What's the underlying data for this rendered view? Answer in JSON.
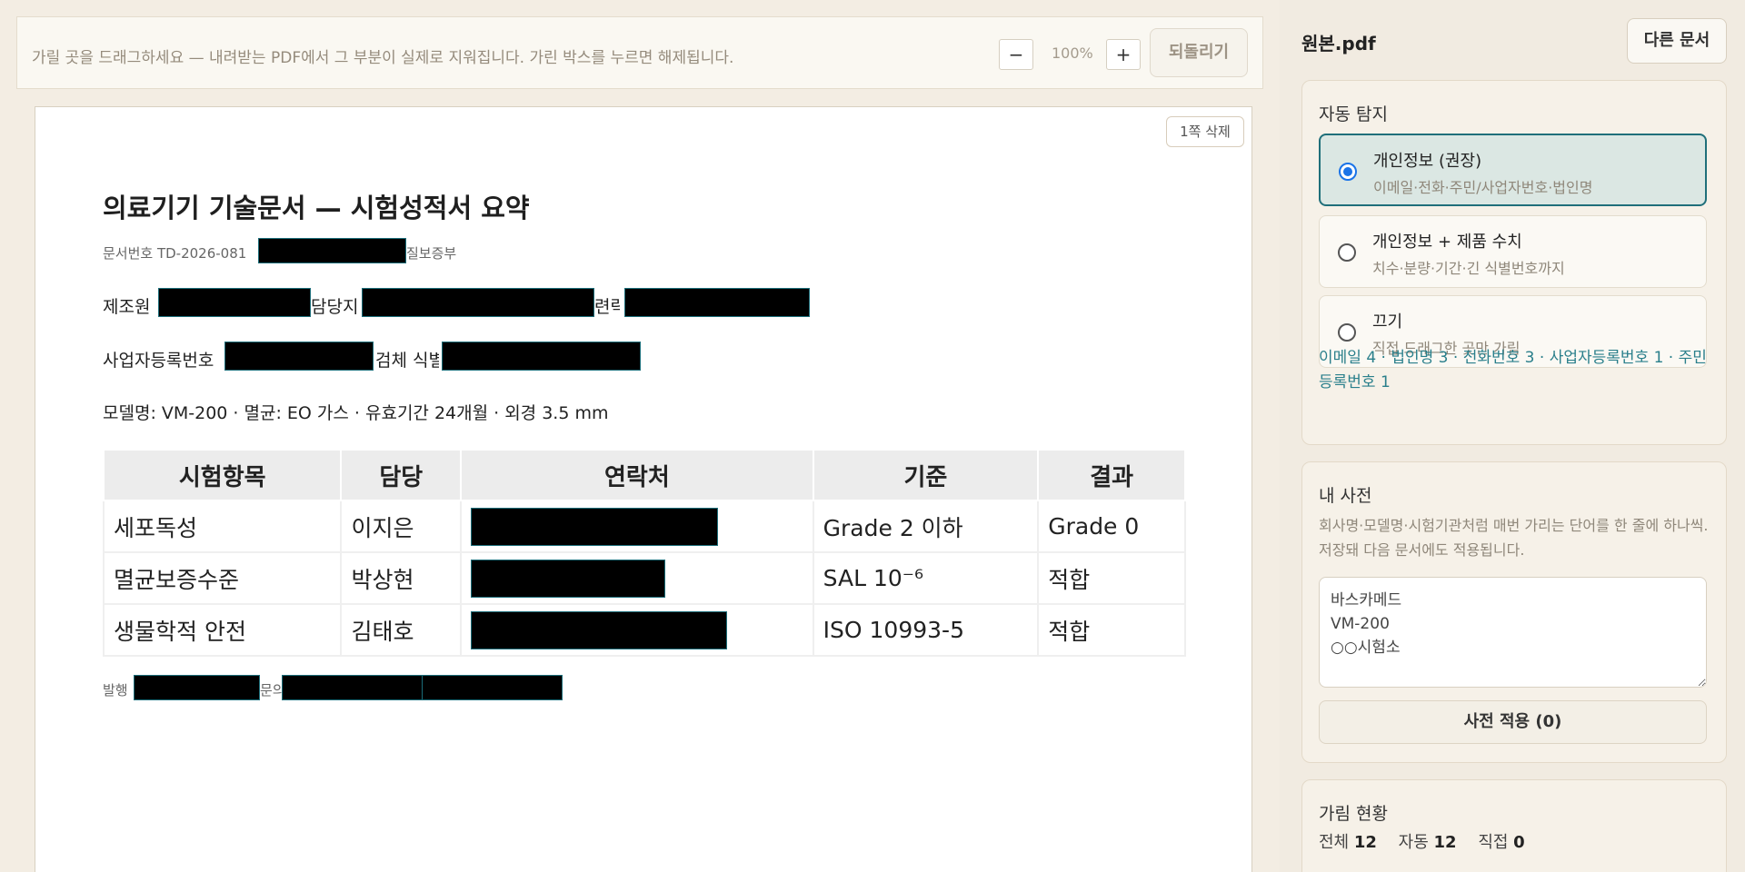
{
  "toolbar": {
    "hint": "가릴 곳을 드래그하세요 — 내려받는 PDF에서 그 부분이 실제로 지워집니다. 가린 박스를 누르면 해제됩니다.",
    "zoom_out": "−",
    "zoom_level": "100%",
    "zoom_in": "+",
    "undo": "되돌리기"
  },
  "page": {
    "delete_page": "1쪽 삭제",
    "title": "의료기기 기술문서 — 시험성적서 요약",
    "doc_no_prefix": "문서번호 TD-2026-081",
    "doc_no_suffix": "질보증부",
    "line_maker_1": "제조원",
    "line_maker_2": "담당지",
    "line_maker_3": "련락처",
    "line_biz_1": "사업자등록번호",
    "line_biz_2": "검체 식별",
    "model_line": "모델명: VM-200 · 멸균: EO 가스 · 유효기간 24개월 · 외경 3.5 mm",
    "table": {
      "headers": [
        "시험항목",
        "담당",
        "연락처",
        "기준",
        "결과"
      ],
      "rows": [
        {
          "item": "세포독성",
          "person": "이지은",
          "standard": "Grade 2 이하",
          "result": "Grade 0"
        },
        {
          "item": "멸균보증수준",
          "person": "박상현",
          "standard": "SAL 10⁻⁶",
          "result": "적합"
        },
        {
          "item": "생물학적 안전",
          "person": "김태호",
          "standard": "ISO 10993-5",
          "result": "적합"
        }
      ]
    },
    "footer_1": "발행",
    "footer_2": "문의"
  },
  "sidebar": {
    "file_name": "원본.pdf",
    "other_doc": "다른 문서",
    "auto_detect": {
      "title": "자동 탐지",
      "options": [
        {
          "title": "개인정보 (권장)",
          "desc": "이메일·전화·주민/사업자번호·법인명",
          "selected": true
        },
        {
          "title": "개인정보 + 제품 수치",
          "desc": "치수·분량·기간·긴 식별번호까지",
          "selected": false
        },
        {
          "title": "끄기",
          "desc": "직접 드래그한 곳만 가림",
          "selected": false
        }
      ],
      "stats": "이메일 4 · 법인명 3 · 전화번호 3 · 사업자등록번호 1 · 주민등록번호 1"
    },
    "dictionary": {
      "title": "내 사전",
      "desc": "회사명·모델명·시험기관처럼 매번 가리는 단어를 한 줄에 하나씩. 저장돼 다음 문서에도 적용됩니다.",
      "value": "바스카메드\nVM-200\n○○시험소",
      "apply": "사전 적용 (0)"
    },
    "status": {
      "title": "가림 현황",
      "total_label": "전체",
      "total": "12",
      "auto_label": "자동",
      "auto": "12",
      "manual_label": "직접",
      "manual": "0"
    }
  },
  "colors": {
    "accent": "#1f6f7a",
    "radio": "#1a73e8",
    "redaction": "#000000"
  }
}
